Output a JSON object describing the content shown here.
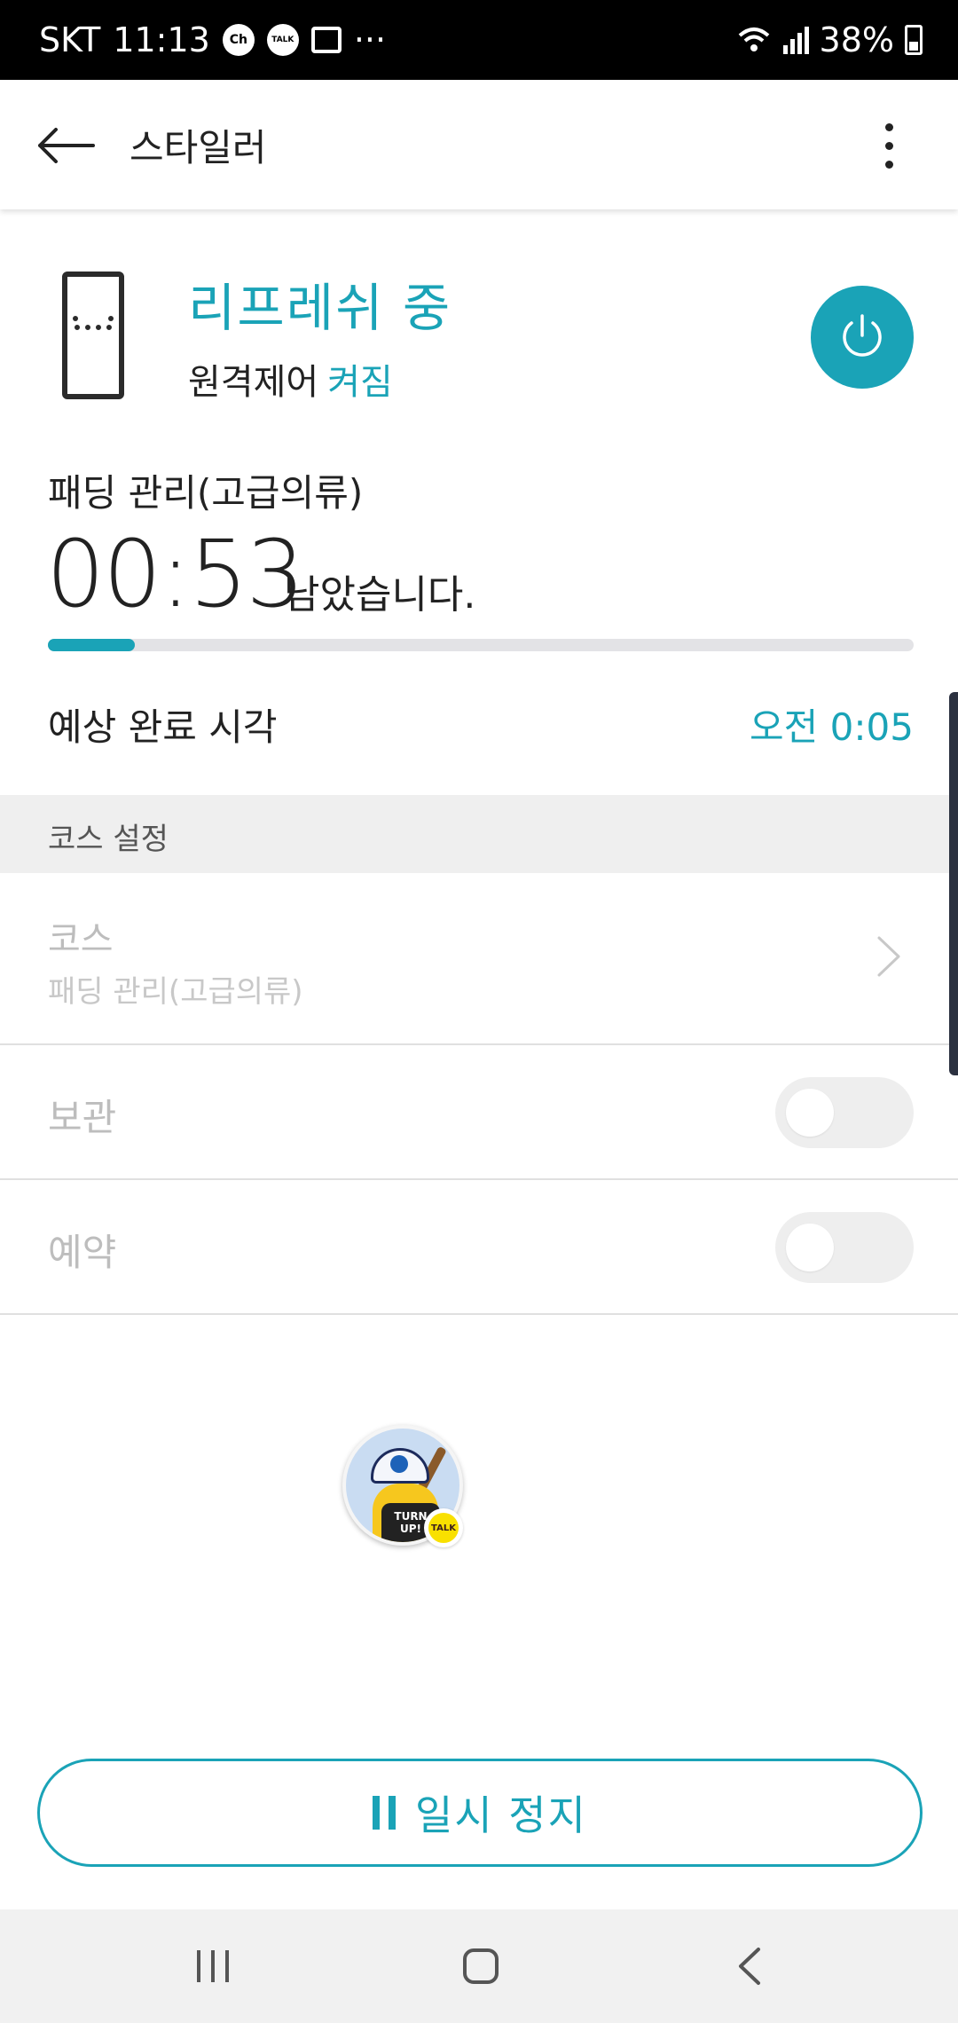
{
  "status_bar": {
    "carrier": "SKT",
    "time": "11:13",
    "notif_ch": "Ch",
    "notif_talk": "TALK",
    "overflow": "···",
    "battery": "38%"
  },
  "app_bar": {
    "title": "스타일러",
    "back_icon": "arrow-left-icon",
    "more_icon": "more-vertical-icon"
  },
  "status": {
    "state": "리프레쉬 중",
    "remote_label": "원격제어",
    "remote_value": "켜짐",
    "course": "패딩 관리(고급의류)",
    "time_remaining": "00:53",
    "time_suffix": "남았습니다.",
    "progress": 0.1,
    "eta_label": "예상 완료 시각",
    "eta_value": "오전 0:05"
  },
  "course_settings": {
    "header": "코스 설정",
    "course_label": "코스",
    "course_value": "패딩 관리(고급의류)",
    "keep_label": "보관",
    "keep_on": false,
    "reserve_label": "예약",
    "reserve_on": false
  },
  "chat_head": {
    "shirt_text_1": "TURN",
    "shirt_text_2": "UP!",
    "badge": "TALK"
  },
  "actions": {
    "pause_label": "일시 정지"
  },
  "colors": {
    "accent": "#1aa3b7",
    "disabled_text": "#bdbdbd",
    "section_bg": "#efefef"
  }
}
